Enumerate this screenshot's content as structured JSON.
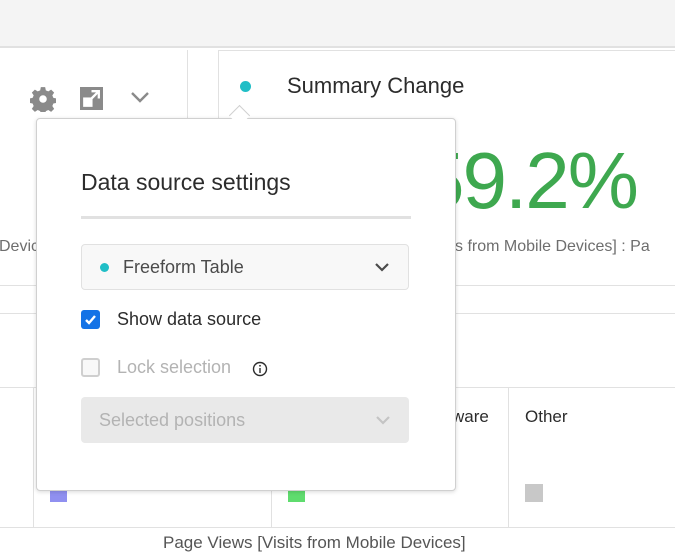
{
  "toolbar": {
    "icons": [
      "gear-icon",
      "expand-icon",
      "chevron-down-icon"
    ]
  },
  "summary": {
    "title": "Summary Change",
    "value": "59.2%",
    "subtitle": "s from Mobile Devices] : Pa",
    "left_subtitle": "Devic",
    "accent": "#20bec6",
    "value_color": "#3ea84f"
  },
  "legend": {
    "items": [
      {
        "label": "ware",
        "color": "#5fdc6e"
      },
      {
        "label": "Other",
        "color": "#c8c8c8"
      }
    ],
    "first_color": "#9090f0",
    "footer": "Page Views [Visits from Mobile Devices]"
  },
  "popover": {
    "title": "Data source settings",
    "source_select": "Freeform Table",
    "show_data_source": {
      "label": "Show data source",
      "checked": true
    },
    "lock_selection": {
      "label": "Lock selection",
      "checked": false,
      "disabled": true
    },
    "positions_select": {
      "placeholder": "Selected positions",
      "disabled": true
    }
  }
}
